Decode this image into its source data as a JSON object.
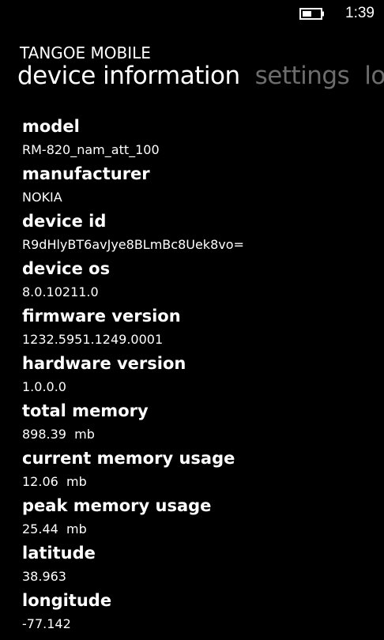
{
  "status_bar": {
    "time": "1:39",
    "battery_icon": "battery-icon",
    "battery_level": 0.5
  },
  "app": {
    "title": "TANGOE MOBILE"
  },
  "pivot": {
    "items": [
      {
        "label": "device information",
        "active": true
      },
      {
        "label": "settings",
        "active": false
      },
      {
        "label": "log",
        "active": false
      }
    ]
  },
  "device_info": [
    {
      "label": "model",
      "value": "RM-820_nam_att_100"
    },
    {
      "label": "manufacturer",
      "value": "NOKIA"
    },
    {
      "label": "device id",
      "value": "R9dHlyBT6avJye8BLmBc8Uek8vo="
    },
    {
      "label": "device os",
      "value": "8.0.10211.0"
    },
    {
      "label": "firmware version",
      "value": "1232.5951.1249.0001"
    },
    {
      "label": "hardware version",
      "value": "1.0.0.0"
    },
    {
      "label": "total memory",
      "value": "898.39  mb"
    },
    {
      "label": "current memory usage",
      "value": "12.06  mb"
    },
    {
      "label": "peak memory usage",
      "value": "25.44  mb"
    },
    {
      "label": "latitude",
      "value": "38.963"
    },
    {
      "label": "longitude",
      "value": "-77.142"
    }
  ],
  "colors": {
    "background": "#000000",
    "text": "#ffffff",
    "inactive_pivot": "#6d6d6d"
  }
}
